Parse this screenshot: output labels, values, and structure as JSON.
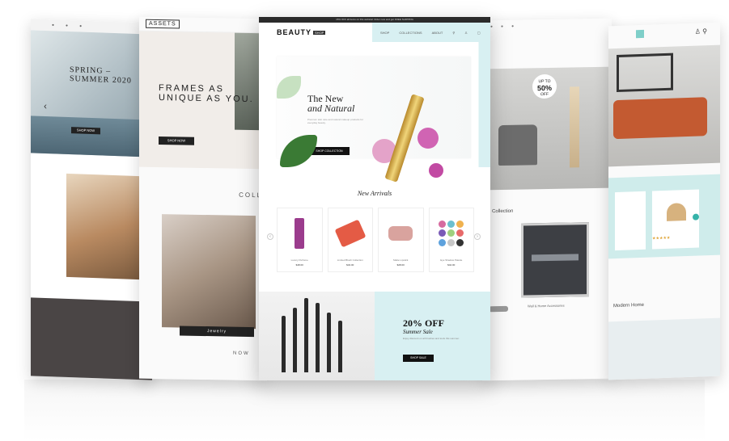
{
  "center": {
    "topbar": "15% OFF all items on this website! Order now and get FREE SHIPPING",
    "brand": "BEAUTY",
    "brand_tag": "SHOP",
    "nav": [
      "SHOP",
      "COLLECTIONS",
      "ABOUT"
    ],
    "hero_title_1": "The New",
    "hero_title_2": "and Natural",
    "hero_sub": "Premium skin care and natural makeup products for everyday beauty.",
    "hero_button": "SHOP COLLECTION",
    "arrivals_title": "New Arrivals",
    "products": [
      {
        "name": "Luxury Perfume",
        "price": "$48.00"
      },
      {
        "name": "Limited Blush Collection",
        "price": "$34.00"
      },
      {
        "name": "Matte Lipstick",
        "price": "$28.00"
      },
      {
        "name": "Eye Shadow Palette",
        "price": "$42.00"
      }
    ],
    "sale_title": "20% OFF",
    "sale_sub": "Summer Sale",
    "sale_text": "Enjoy discount on all brushes and tools this summer.",
    "sale_button": "SHOP SALE"
  },
  "left": {
    "hero_title": "SPRING – SUMMER 2020",
    "hero_button": "SHOP NOW"
  },
  "second": {
    "logo": "ASSETS",
    "hero_title": "FRAMES AS UNIQUE AS YOU.",
    "hero_button": "SHOP NOW",
    "collection_label": "COLL",
    "jewelry_label": "Jewelry",
    "now_label": "NOW"
  },
  "fourth": {
    "badge_top": "UP TO",
    "badge_pct": "50%",
    "badge_bottom": "OFF",
    "collection_label": "Collection",
    "caption": "Wall & Home Accessories"
  },
  "right": {
    "home_label": "Modern Home"
  },
  "colors": {
    "mint": "#d8f0f2",
    "dark": "#111111",
    "teal_dot": "#36b3a9",
    "sofa": "#c35a31"
  }
}
